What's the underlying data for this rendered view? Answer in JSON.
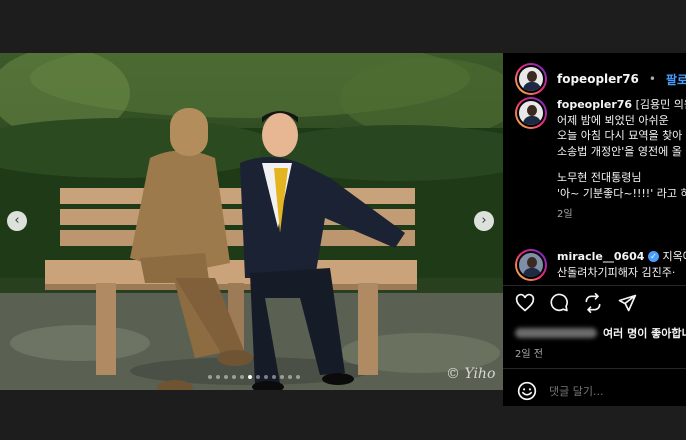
{
  "post": {
    "author": "fopeopler76",
    "follow_label": "팔로우",
    "separator": "•",
    "caption_lines": [
      "[김용민 의원",
      "어제 밤에 뵈었던 아쉬운",
      "오늘 아침 다시 묘역을 찾아",
      "소송법 개정안'을 영전에 올",
      "노무현 전대통령님",
      "'아~ 기분좋다~!!!!' 라고 하"
    ],
    "caption_time": "2일",
    "watermark": "© Yiho",
    "slide_count": 12,
    "active_slide": 5
  },
  "comment": {
    "author": "miracle__0604",
    "verified_mark": "✓",
    "text_line1": "지옥에",
    "text_line2": "산돌려차기피해자 김진주·"
  },
  "likes": {
    "text": "여러 명이 좋아합니"
  },
  "post_time": "2일 전",
  "add_comment": {
    "placeholder": "댓글 달기..."
  },
  "nav": {
    "prev": "‹",
    "next": "›"
  },
  "icons": [
    "heart-icon",
    "comment-icon",
    "share-icon",
    "send-icon",
    "emoji-icon"
  ],
  "colors": {
    "accent": "#4a9eff",
    "background": "#000000",
    "frame": "#1d1d1d"
  }
}
